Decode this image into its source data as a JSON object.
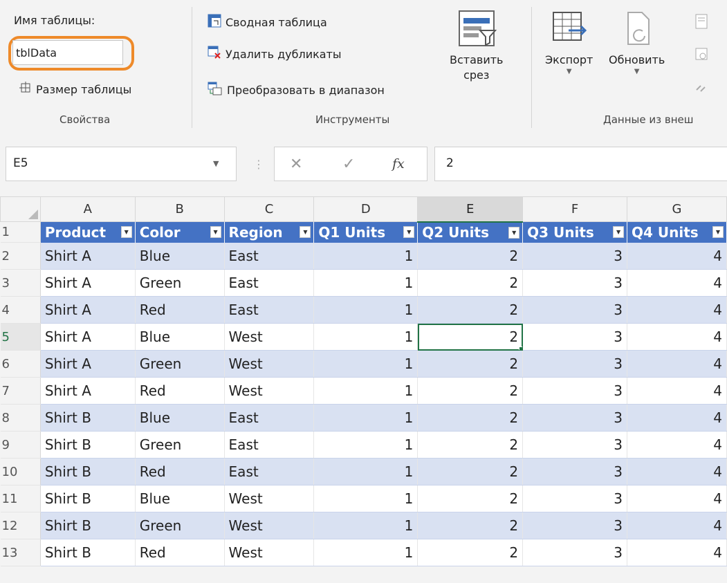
{
  "ribbon": {
    "properties": {
      "name_label": "Имя таблицы:",
      "name_value": "tblData",
      "resize_label": "Размер таблицы",
      "group_label": "Свойства"
    },
    "tools": {
      "pivot_label": "Сводная таблица",
      "dedupe_label": "Удалить дубликаты",
      "convert_label": "Преобразовать в диапазон",
      "slicer_label_1": "Вставить",
      "slicer_label_2": "срез",
      "group_label": "Инструменты"
    },
    "external": {
      "export_label": "Экспорт",
      "refresh_label": "Обновить",
      "group_label": "Данные из внеш"
    }
  },
  "formula_bar": {
    "name_box": "E5",
    "fx": "fx",
    "value": "2"
  },
  "sheet": {
    "columns": [
      "A",
      "B",
      "C",
      "D",
      "E",
      "F",
      "G"
    ],
    "selected_column": "E",
    "headers": [
      "Product",
      "Color",
      "Region",
      "Q1 Units",
      "Q2 Units",
      "Q3 Units",
      "Q4 Units"
    ],
    "rows": [
      [
        "Shirt A",
        "Blue",
        "East",
        "1",
        "2",
        "3",
        "4"
      ],
      [
        "Shirt A",
        "Green",
        "East",
        "1",
        "2",
        "3",
        "4"
      ],
      [
        "Shirt A",
        "Red",
        "East",
        "1",
        "2",
        "3",
        "4"
      ],
      [
        "Shirt A",
        "Blue",
        "West",
        "1",
        "2",
        "3",
        "4"
      ],
      [
        "Shirt A",
        "Green",
        "West",
        "1",
        "2",
        "3",
        "4"
      ],
      [
        "Shirt A",
        "Red",
        "West",
        "1",
        "2",
        "3",
        "4"
      ],
      [
        "Shirt B",
        "Blue",
        "East",
        "1",
        "2",
        "3",
        "4"
      ],
      [
        "Shirt B",
        "Green",
        "East",
        "1",
        "2",
        "3",
        "4"
      ],
      [
        "Shirt B",
        "Red",
        "East",
        "1",
        "2",
        "3",
        "4"
      ],
      [
        "Shirt B",
        "Blue",
        "West",
        "1",
        "2",
        "3",
        "4"
      ],
      [
        "Shirt B",
        "Green",
        "West",
        "1",
        "2",
        "3",
        "4"
      ],
      [
        "Shirt B",
        "Red",
        "West",
        "1",
        "2",
        "3",
        "4"
      ]
    ],
    "active_row": 5,
    "colors": {
      "header_fill": "#4472c4",
      "band_fill": "#d9e1f2",
      "selection": "#217346",
      "highlight_ring": "#ee8a2a"
    }
  }
}
